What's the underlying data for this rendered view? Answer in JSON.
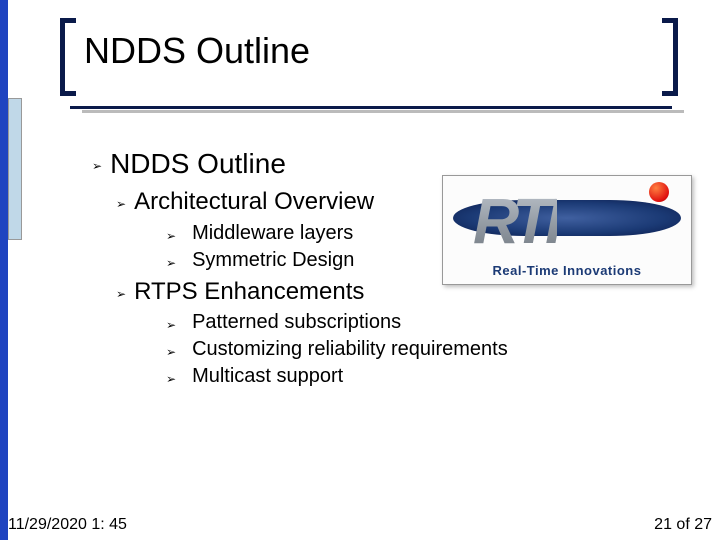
{
  "title": "NDDS Outline",
  "outline": {
    "heading": "NDDS Outline",
    "sections": [
      {
        "heading": "Architectural Overview",
        "items": [
          "Middleware layers",
          "Symmetric Design"
        ]
      },
      {
        "heading": "RTPS Enhancements",
        "items": [
          "Patterned subscriptions",
          "Customizing reliability requirements",
          "Multicast support"
        ]
      }
    ]
  },
  "logo": {
    "letters": "RTI",
    "subtitle": "Real-Time Innovations"
  },
  "footer": {
    "datetime": "11/29/2020 1: 45",
    "page": "21 of 27"
  }
}
